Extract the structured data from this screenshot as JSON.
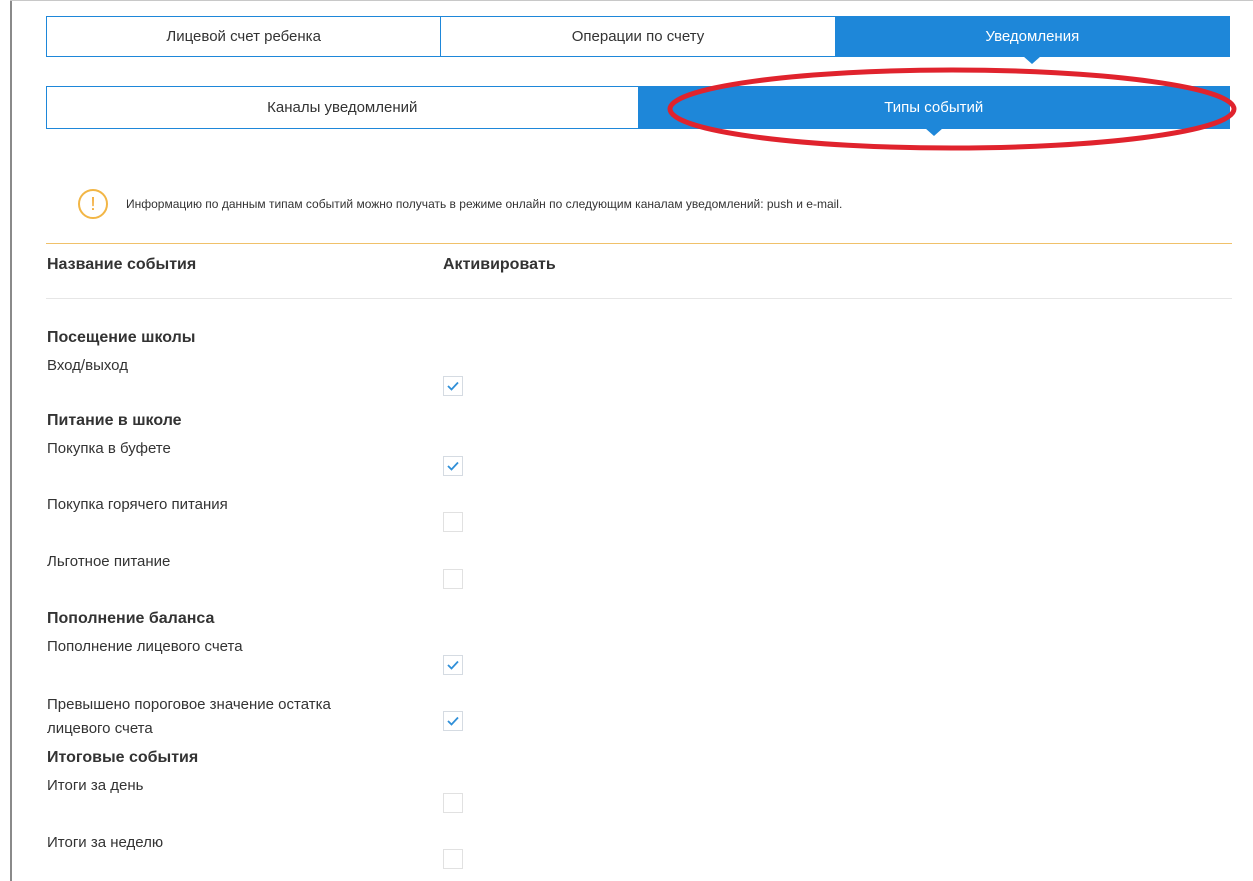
{
  "tabs_main": [
    {
      "label": "Лицевой счет ребенка",
      "active": false
    },
    {
      "label": "Операции по счету",
      "active": false
    },
    {
      "label": "Уведомления",
      "active": true
    }
  ],
  "tabs_sub": [
    {
      "label": "Каналы уведомлений",
      "active": false
    },
    {
      "label": "Типы событий",
      "active": true
    }
  ],
  "info": {
    "text": "Информацию по данным типам событий можно получать в режиме онлайн по следующим каналам уведомлений: push и e-mail.",
    "icon": "exclamation-icon"
  },
  "table": {
    "col_event": "Название события",
    "col_activate": "Активировать"
  },
  "sections": [
    {
      "title": "Посещение школы",
      "events": [
        {
          "label": "Вход/выход",
          "checked": true
        }
      ]
    },
    {
      "title": "Питание в школе",
      "events": [
        {
          "label": "Покупка в буфете",
          "checked": true
        },
        {
          "label": "Покупка горячего питания",
          "checked": false
        },
        {
          "label": "Льготное питание",
          "checked": false
        }
      ]
    },
    {
      "title": "Пополнение баланса",
      "events": [
        {
          "label": "Пополнение лицевого счета",
          "checked": true
        },
        {
          "label": "Превышено пороговое значение остатка лицевого счета",
          "checked": true
        }
      ]
    },
    {
      "title": "Итоговые события",
      "events": [
        {
          "label": "Итоги за день",
          "checked": false
        },
        {
          "label": "Итоги за неделю",
          "checked": false
        }
      ]
    }
  ],
  "colors": {
    "accent": "#1e87d9",
    "highlight": "#e0232d",
    "info_icon": "#f2b646",
    "divider": "#f0c16a",
    "check": "#2f8fd8"
  }
}
